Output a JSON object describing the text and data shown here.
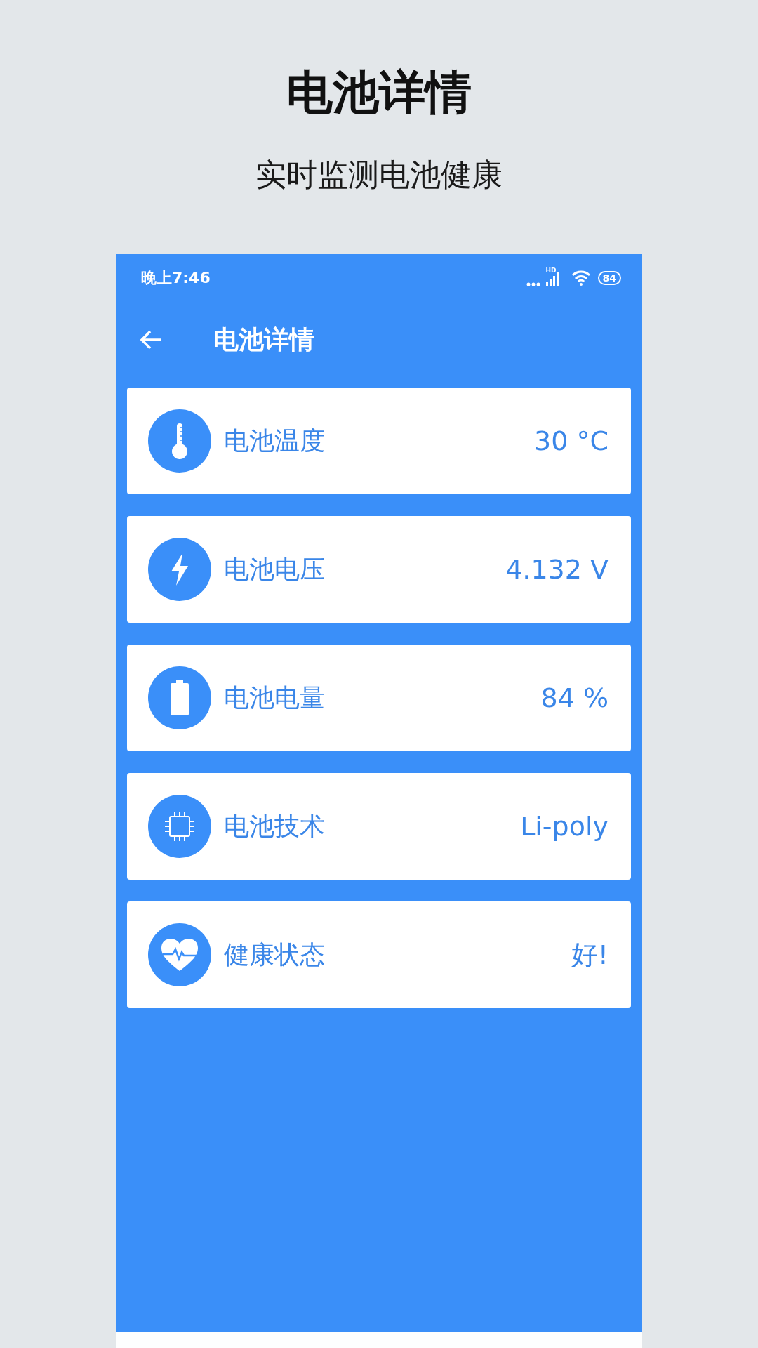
{
  "headline": {
    "title": "电池详情",
    "subtitle": "实时监测电池健康"
  },
  "status_bar": {
    "time": "晚上7:46",
    "network": "HD",
    "battery": "84"
  },
  "toolbar": {
    "title": "电池详情"
  },
  "items": [
    {
      "kind": "temperature",
      "label": "电池温度",
      "value": "30 °C"
    },
    {
      "kind": "voltage",
      "label": "电池电压",
      "value": "4.132 V"
    },
    {
      "kind": "level",
      "label": "电池电量",
      "value": "84 %"
    },
    {
      "kind": "technology",
      "label": "电池技术",
      "value": "Li-poly"
    },
    {
      "kind": "health",
      "label": "健康状态",
      "value": "好!"
    }
  ]
}
